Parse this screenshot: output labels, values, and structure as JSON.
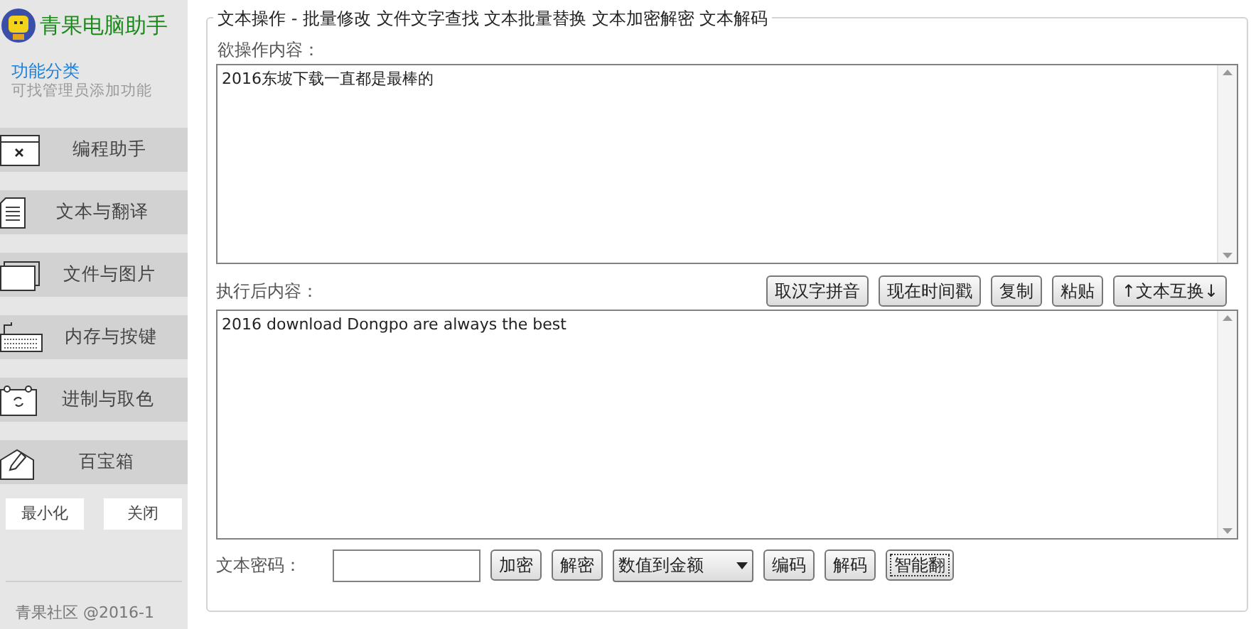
{
  "app": {
    "title": "青果电脑助手",
    "section_title": "功能分类",
    "section_hint": "可找管理员添加功能"
  },
  "sidebar": {
    "items": [
      {
        "label": "编程助手",
        "kind": "window"
      },
      {
        "label": "文本与翻译",
        "kind": "document"
      },
      {
        "label": "文件与图片",
        "kind": "folder"
      },
      {
        "label": "内存与按键",
        "kind": "keyboard"
      },
      {
        "label": "进制与取色",
        "kind": "calendar"
      },
      {
        "label": "百宝箱",
        "kind": "envelope"
      }
    ],
    "buttons": [
      "最小化",
      "关闭"
    ],
    "footer": "青果社区 @2016-1"
  },
  "panel": {
    "title": "文本操作 - 批量修改 文件文字查找 文本批量替换 文本加密解密 文本解码",
    "input_label": "欲操作内容：",
    "input_text": "2016东坡下载一直都是最棒的",
    "output_label": "执行后内容：",
    "output_text": "2016 download Dongpo are always the best",
    "actions": [
      "取汉字拼音",
      "现在时间戳",
      "复制",
      "粘贴",
      "↑文本互换↓"
    ],
    "password_label": "文本密码：",
    "bottom_controls": [
      {
        "kind": "button",
        "label": "加密"
      },
      {
        "kind": "button",
        "label": "解密"
      },
      {
        "kind": "select",
        "label": "数值到金额"
      },
      {
        "kind": "button",
        "label": "编码"
      },
      {
        "kind": "button",
        "label": "解码"
      },
      {
        "kind": "focused",
        "label": "智能翻"
      }
    ]
  }
}
